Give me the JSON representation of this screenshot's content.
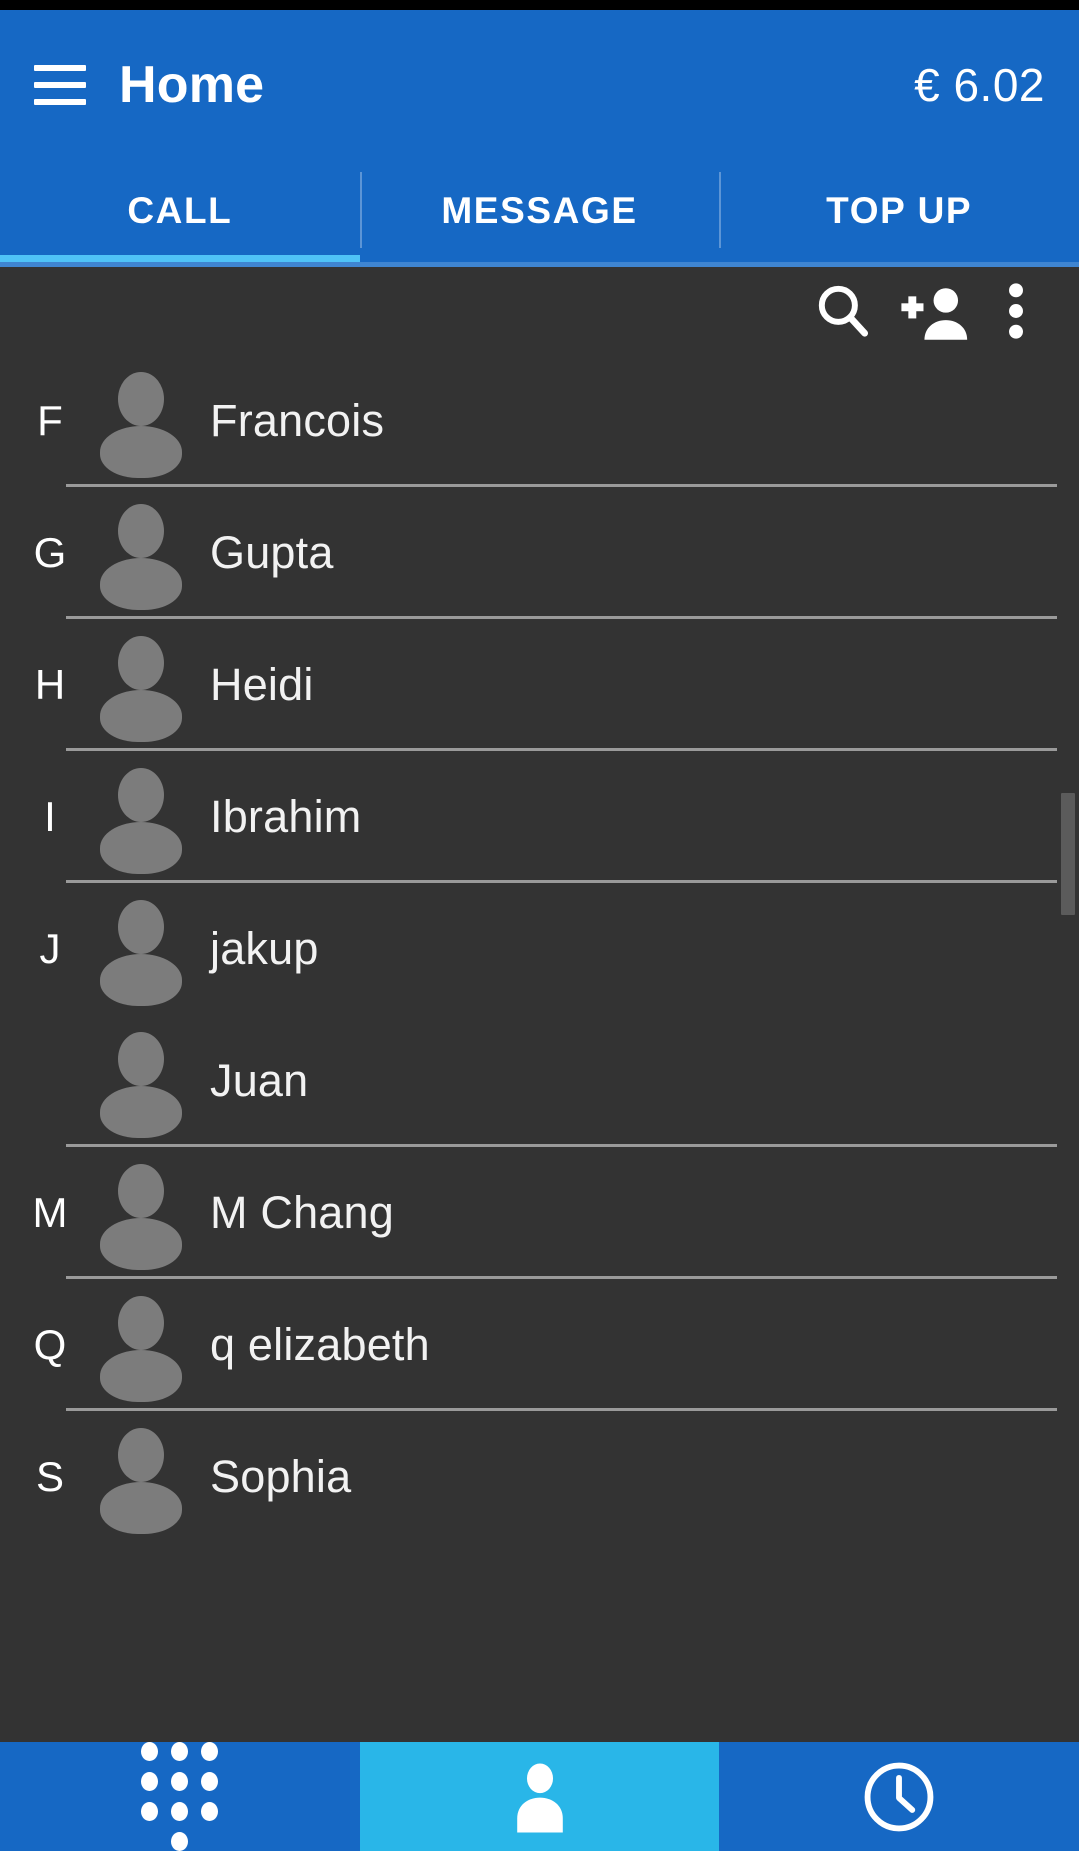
{
  "header": {
    "menu_icon": "hamburger-menu-icon",
    "title": "Home",
    "balance": "€ 6.02"
  },
  "tabs": {
    "items": [
      {
        "label": "CALL",
        "active": true
      },
      {
        "label": "MESSAGE",
        "active": false
      },
      {
        "label": "TOP UP",
        "active": false
      }
    ],
    "indicator_color": "#4fc3f7"
  },
  "list_toolbar": {
    "search_icon": "search-icon",
    "add_contact_icon": "add-person-icon",
    "overflow_icon": "more-vertical-icon"
  },
  "contacts": [
    {
      "section": "F",
      "name": "Francois",
      "divider": true
    },
    {
      "section": "G",
      "name": "Gupta",
      "divider": true
    },
    {
      "section": "H",
      "name": "Heidi",
      "divider": true
    },
    {
      "section": "I",
      "name": "Ibrahim",
      "divider": true
    },
    {
      "section": "J",
      "name": "jakup",
      "divider": false
    },
    {
      "section": "",
      "name": "Juan",
      "divider": true
    },
    {
      "section": "M",
      "name": "M Chang",
      "divider": true
    },
    {
      "section": "Q",
      "name": "q elizabeth",
      "divider": true
    },
    {
      "section": "S",
      "name": "Sophia",
      "divider": false
    }
  ],
  "bottom_nav": {
    "items": [
      {
        "icon": "dialpad-icon",
        "active": false
      },
      {
        "icon": "contacts-person-icon",
        "active": true
      },
      {
        "icon": "recents-clock-icon",
        "active": false
      }
    ],
    "active_color": "#29b6e8"
  },
  "colors": {
    "header_blue": "#1668c4",
    "panel_dark": "#333333",
    "avatar_gray": "#7c7c7c",
    "divider_gray": "#9a9a9a"
  }
}
